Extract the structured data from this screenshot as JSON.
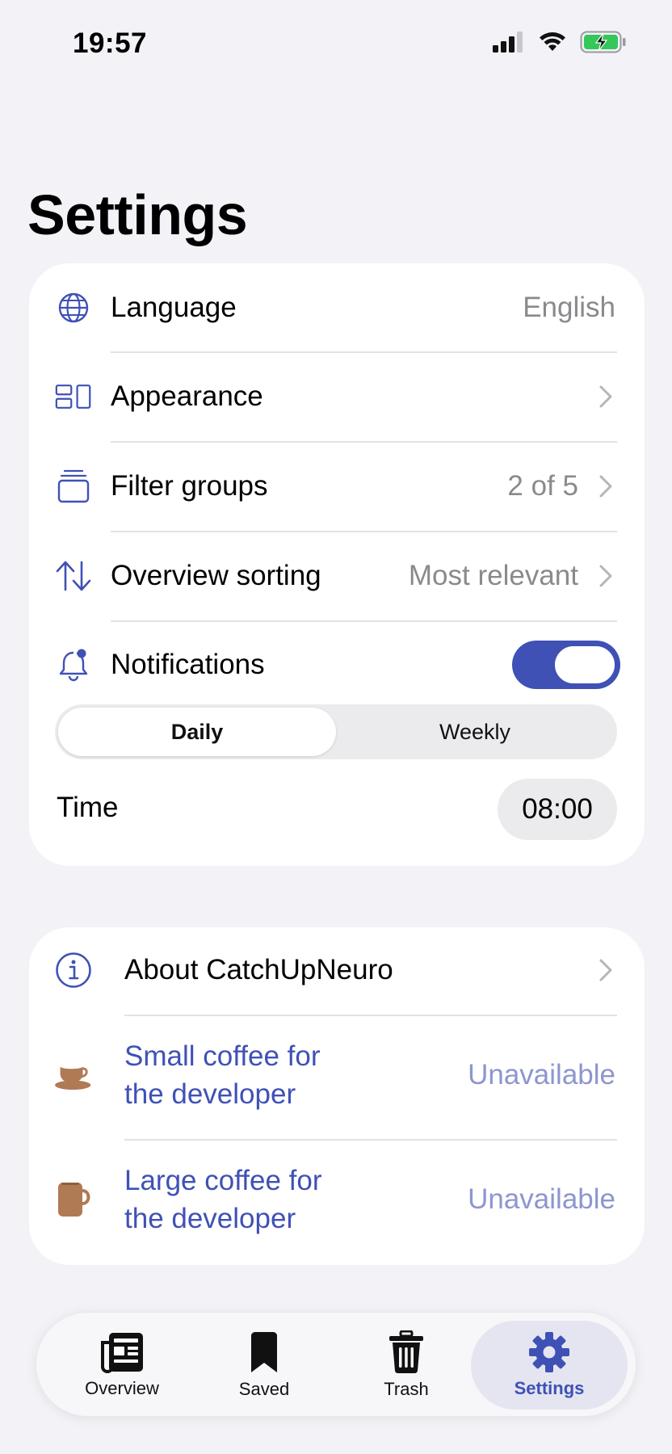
{
  "status_bar": {
    "time": "19:57",
    "icons": [
      "signal-icon",
      "wifi-icon",
      "battery-charging-icon"
    ]
  },
  "page": {
    "title": "Settings"
  },
  "colors": {
    "accent": "#3f51b5",
    "unavailable": "#8d96cf",
    "coffee": "#b07a55",
    "background": "#f2f2f7"
  },
  "general": {
    "language": {
      "label": "Language",
      "value": "English",
      "icon": "globe-icon"
    },
    "appearance": {
      "label": "Appearance",
      "icon": "layout-icon"
    },
    "filter_groups": {
      "label": "Filter groups",
      "value": "2 of 5",
      "icon": "stack-icon"
    },
    "overview_sorting": {
      "label": "Overview sorting",
      "value": "Most relevant",
      "icon": "sort-arrows-icon"
    },
    "notifications": {
      "label": "Notifications",
      "enabled": true,
      "icon": "bell-badge-icon",
      "frequency_options": [
        "Daily",
        "Weekly"
      ],
      "selected_frequency": "Daily"
    },
    "time": {
      "label": "Time",
      "value": "08:00"
    }
  },
  "about": {
    "about_app": {
      "label": "About CatchUpNeuro",
      "icon": "info-icon"
    },
    "small_coffee": {
      "label_line1": "Small coffee for",
      "label_line2": "the developer",
      "value": "Unavailable",
      "icon": "coffee-cup-icon"
    },
    "large_coffee": {
      "label_line1": "Large coffee for",
      "label_line2": "the developer",
      "value": "Unavailable",
      "icon": "mug-icon"
    }
  },
  "tabbar": {
    "tabs": [
      {
        "label": "Overview",
        "icon": "newspaper-icon"
      },
      {
        "label": "Saved",
        "icon": "bookmark-icon"
      },
      {
        "label": "Trash",
        "icon": "trash-icon"
      },
      {
        "label": "Settings",
        "icon": "gear-icon"
      }
    ],
    "active": "Settings"
  }
}
